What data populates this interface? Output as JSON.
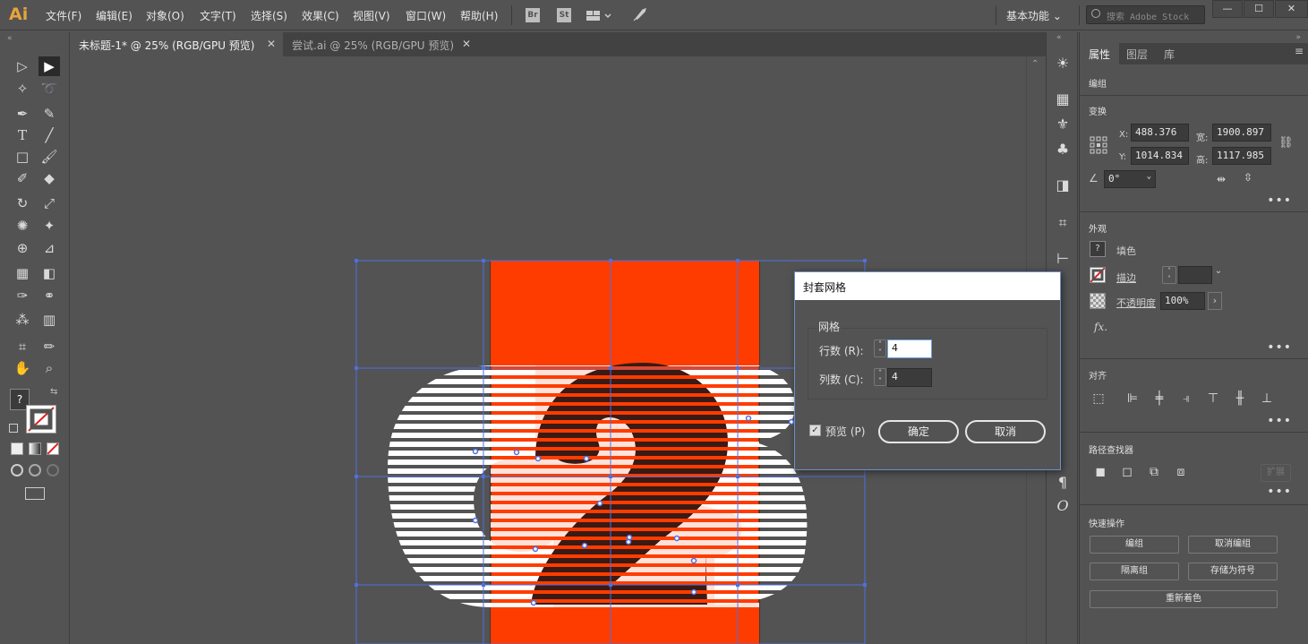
{
  "app": {
    "logo": "Ai",
    "menus": [
      "文件(F)",
      "编辑(E)",
      "对象(O)",
      "文字(T)",
      "选择(S)",
      "效果(C)",
      "视图(V)",
      "窗口(W)",
      "帮助(H)"
    ],
    "bridge_label": "Br",
    "stock_label": "St",
    "workspace": "基本功能",
    "search_placeholder": "搜索 Adobe Stock"
  },
  "tabs": [
    {
      "title": "未标题-1* @ 25% (RGB/GPU 预览)",
      "active": true
    },
    {
      "title": "尝试.ai @ 25% (RGB/GPU 预览)",
      "active": false
    }
  ],
  "right_panel": {
    "tabs": [
      "属性",
      "图层",
      "库"
    ],
    "selection_type": "编组",
    "transform": {
      "title": "变换",
      "x_label": "X:",
      "x": "488.376",
      "y_label": "Y:",
      "y": "1014.834",
      "w_label": "宽:",
      "w": "1900.897",
      "h_label": "高:",
      "h": "1117.985",
      "angle": "0°"
    },
    "appearance": {
      "title": "外观",
      "fill": "填色",
      "stroke": "描边",
      "opacity_label": "不透明度",
      "opacity": "100%",
      "fx": "fx."
    },
    "align_title": "对齐",
    "pathfinder_title": "路径查找器",
    "pathfinder_expand": "扩展",
    "quick_actions": {
      "title": "快速操作",
      "group": "编组",
      "ungroup": "取消编组",
      "isolate": "隔离组",
      "save_symbol": "存储为符号",
      "recolor": "重新着色"
    }
  },
  "dialog": {
    "title": "封套网格",
    "group_label": "网格",
    "rows_label": "行数 (R):",
    "rows": "4",
    "cols_label": "列数 (C):",
    "cols": "4",
    "preview_label": "预览 (P)",
    "preview_checked": true,
    "ok": "确定",
    "cancel": "取消"
  },
  "colors": {
    "artboard": "#ff3c00",
    "shape_dark": "#3a1a14",
    "shape_white": "#ffffff",
    "selection": "#4e6fe0",
    "ui_bg": "#535353"
  }
}
